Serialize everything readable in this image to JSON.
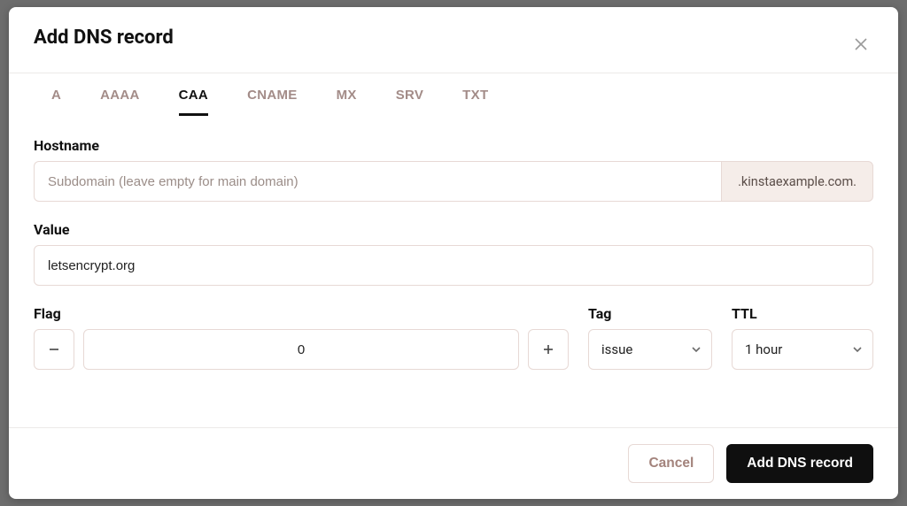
{
  "modal": {
    "title": "Add DNS record"
  },
  "tabs": {
    "items": [
      "A",
      "AAAA",
      "CAA",
      "CNAME",
      "MX",
      "SRV",
      "TXT"
    ],
    "active": "CAA"
  },
  "fields": {
    "hostname": {
      "label": "Hostname",
      "placeholder": "Subdomain (leave empty for main domain)",
      "value": "",
      "suffix": ".kinstaexample.com."
    },
    "value": {
      "label": "Value",
      "value": "letsencrypt.org"
    },
    "flag": {
      "label": "Flag",
      "value": "0"
    },
    "tag": {
      "label": "Tag",
      "selected": "issue"
    },
    "ttl": {
      "label": "TTL",
      "selected": "1 hour"
    }
  },
  "footer": {
    "cancel": "Cancel",
    "submit": "Add DNS record"
  }
}
